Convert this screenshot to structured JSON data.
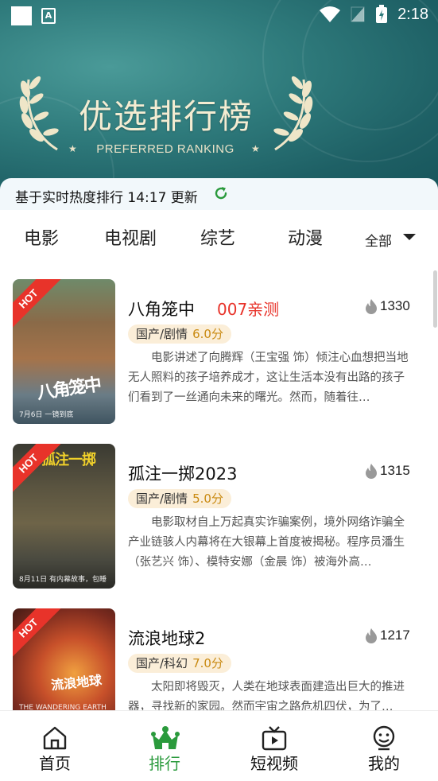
{
  "status_bar": {
    "time": "2:18"
  },
  "banner": {
    "title": "优选排行榜",
    "subtitle": "PREFERRED RANKING"
  },
  "notice": {
    "text": "基于实时热度排行 14:17 更新"
  },
  "categories": [
    "电影",
    "电视剧",
    "综艺",
    "动漫"
  ],
  "filter_label": "全部",
  "hot_badge": "HOT",
  "colors": {
    "accent_green": "#2a9a3c",
    "hot_red": "#e8332a",
    "score_gold": "#c98a12",
    "tag_bg": "#fbeed8",
    "banner_teal": "#2f7b7c"
  },
  "movies": [
    {
      "title": "八角笼中",
      "promo": "007亲测",
      "heat": "1330",
      "genre": "国产/剧情",
      "score": "6.0分",
      "description": "电影讲述了向腾辉（王宝强 饰）倾注心血想把当地无人照料的孩子培养成才，这让生活本没有出路的孩子们看到了一丝通向未来的曙光。然而，随着往…",
      "poster_title": "八角笼中",
      "poster_caption": "7月6日 一镜到底"
    },
    {
      "title": "孤注一掷2023",
      "promo": "",
      "heat": "1315",
      "genre": "国产/剧情",
      "score": "5.0分",
      "description": "电影取材自上万起真实诈骗案例，境外网络诈骗全产业链骇人内幕将在大银幕上首度被揭秘。程序员潘生（张艺兴 饰）、模特安娜（金晨 饰）被海外高…",
      "poster_title": "孤注一掷",
      "poster_caption": "8月11日 有内幕故事，包睡"
    },
    {
      "title": "流浪地球2",
      "promo": "",
      "heat": "1217",
      "genre": "国产/科幻",
      "score": "7.0分",
      "description": "太阳即将毁灭，人类在地球表面建造出巨大的推进器，寻找新的家园。然而宇宙之路危机四伏，为了…",
      "poster_title": "流浪地球",
      "poster_caption": "THE WANDERING EARTH"
    }
  ],
  "bottom_nav": [
    {
      "label": "首页",
      "icon": "home-icon"
    },
    {
      "label": "排行",
      "icon": "crown-icon"
    },
    {
      "label": "短视频",
      "icon": "video-icon"
    },
    {
      "label": "我的",
      "icon": "profile-icon"
    }
  ]
}
